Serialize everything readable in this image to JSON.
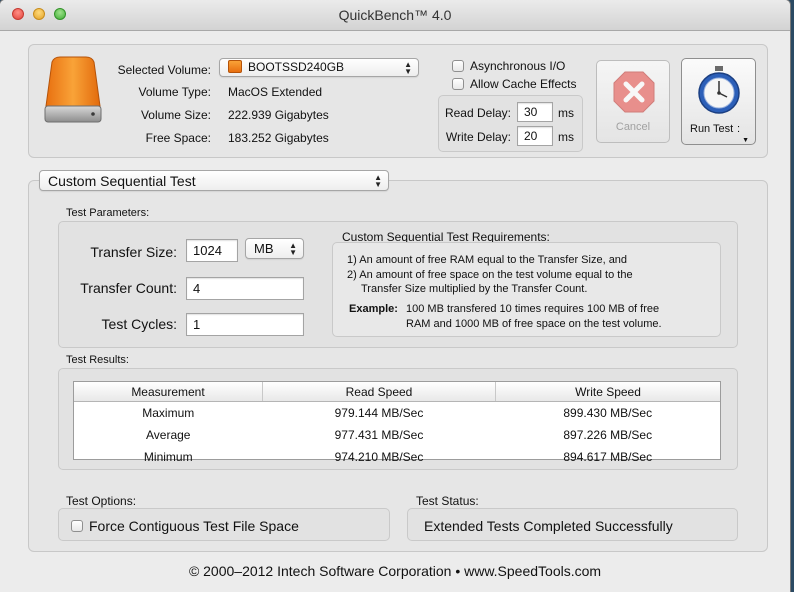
{
  "window": {
    "title": "QuickBench™ 4.0"
  },
  "volume": {
    "selected_label": "Selected Volume:",
    "selected_value": "BOOTSSD240GB",
    "type_label": "Volume Type:",
    "type_value": "MacOS Extended",
    "size_label": "Volume Size:",
    "size_value": "222.939 Gigabytes",
    "free_label": "Free Space:",
    "free_value": "183.252 Gigabytes"
  },
  "options": {
    "async_label": "Asynchronous I/O",
    "cache_label": "Allow Cache Effects",
    "read_delay_label": "Read Delay:",
    "read_delay_value": "30",
    "read_delay_unit": "ms",
    "write_delay_label": "Write Delay:",
    "write_delay_value": "20",
    "write_delay_unit": "ms"
  },
  "buttons": {
    "cancel": "Cancel",
    "run_test": "Run Test"
  },
  "test_type": "Custom Sequential Test",
  "params": {
    "heading": "Test Parameters:",
    "transfer_size_label": "Transfer Size:",
    "transfer_size_value": "1024",
    "transfer_size_unit": "MB",
    "transfer_count_label": "Transfer Count:",
    "transfer_count_value": "4",
    "cycles_label": "Test Cycles:",
    "cycles_value": "1"
  },
  "requirements": {
    "heading": "Custom Sequential Test Requirements:",
    "line1": "1) An amount of free RAM equal to the Transfer Size, and",
    "line2a": "2) An amount of free space on the test volume equal to the",
    "line2b": "Transfer Size multiplied by the Transfer Count.",
    "example_label": "Example:",
    "example_line1": "100 MB transfered 10 times requires 100 MB of free",
    "example_line2": "RAM and 1000 MB of free space on the test volume."
  },
  "results": {
    "heading": "Test Results:",
    "columns": [
      "Measurement",
      "Read Speed",
      "Write Speed"
    ],
    "rows": [
      [
        "Maximum",
        "979.144 MB/Sec",
        "899.430 MB/Sec"
      ],
      [
        "Average",
        "977.431 MB/Sec",
        "897.226 MB/Sec"
      ],
      [
        "Minimum",
        "974.210 MB/Sec",
        "894.617 MB/Sec"
      ]
    ]
  },
  "test_options": {
    "heading": "Test Options:",
    "force_contiguous": "Force Contiguous Test File Space"
  },
  "status": {
    "heading": "Test Status:",
    "text": "Extended Tests Completed Successfully"
  },
  "footer": "© 2000–2012 Intech Software Corporation • www.SpeedTools.com"
}
